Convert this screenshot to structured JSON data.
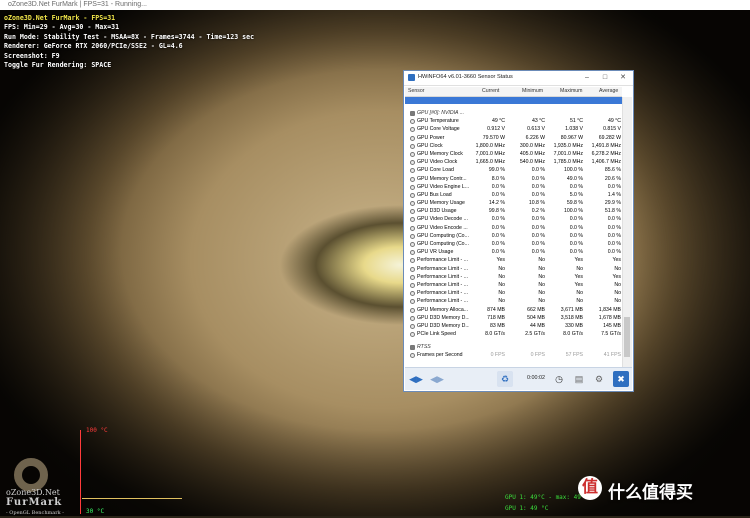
{
  "furmark": {
    "window_title": "oZone3D.Net FurMark | FPS=31 - Running...",
    "hud_title": "oZone3D.Net FurMark - FPS=31",
    "hud_lines": [
      "FPS: Min=29 - Avg=30 - Max=31",
      "Run Mode: Stability Test - MSAA=8X - Frames=3744 - Time=123 sec",
      "Renderer: GeForce RTX 2060/PCIe/SSE2 - GL=4.6",
      "Screenshot: F9",
      "Toggle Fur Rendering: SPACE"
    ],
    "temp_max_label": "100 °C",
    "temp_min_label": "30 °C",
    "logo_top": "oZone3D.Net",
    "logo_big": "FurMark",
    "logo_sub": "- OpenGL Benchmark -",
    "graph_line1": "GPU 1: 49°C - max: 49°C",
    "graph_line2": "GPU 1: 49 °C"
  },
  "watermark": {
    "icon": "值",
    "text": "什么值得买",
    "icon_color": "#cc2e2e"
  },
  "hwinfo": {
    "title": "HWiNFO64 v6.01-3660 Sensor Status",
    "columns": [
      "Sensor",
      "Current",
      "Minimum",
      "Maximum",
      "Average"
    ],
    "group": "GPU [#0]: NVIDIA ...",
    "rows": [
      {
        "name": "GPU Temperature",
        "cur": "49 °C",
        "min": "43 °C",
        "max": "51 °C",
        "avg": "49 °C"
      },
      {
        "name": "GPU Core Voltage",
        "cur": "0.912 V",
        "min": "0.613 V",
        "max": "1.038 V",
        "avg": "0.815 V"
      },
      {
        "name": "GPU Power",
        "cur": "79.570 W",
        "min": "6.226 W",
        "max": "80.967 W",
        "avg": "69.282 W"
      },
      {
        "name": "GPU Clock",
        "cur": "1,800.0 MHz",
        "min": "300.0 MHz",
        "max": "1,935.0 MHz",
        "avg": "1,491.8 MHz"
      },
      {
        "name": "GPU Memory Clock",
        "cur": "7,001.0 MHz",
        "min": "405.0 MHz",
        "max": "7,001.0 MHz",
        "avg": "6,278.2 MHz"
      },
      {
        "name": "GPU Video Clock",
        "cur": "1,665.0 MHz",
        "min": "540.0 MHz",
        "max": "1,785.0 MHz",
        "avg": "1,406.7 MHz"
      },
      {
        "name": "GPU Core Load",
        "cur": "99.0 %",
        "min": "0.0 %",
        "max": "100.0 %",
        "avg": "85.6 %"
      },
      {
        "name": "GPU Memory Contr...",
        "cur": "8.0 %",
        "min": "0.0 %",
        "max": "49.0 %",
        "avg": "20.6 %"
      },
      {
        "name": "GPU Video Engine L...",
        "cur": "0.0 %",
        "min": "0.0 %",
        "max": "0.0 %",
        "avg": "0.0 %"
      },
      {
        "name": "GPU Bus Load",
        "cur": "0.0 %",
        "min": "0.0 %",
        "max": "5.0 %",
        "avg": "1.4 %"
      },
      {
        "name": "GPU Memory Usage",
        "cur": "14.2 %",
        "min": "10.8 %",
        "max": "59.8 %",
        "avg": "29.9 %"
      },
      {
        "name": "GPU D3D Usage",
        "cur": "99.8 %",
        "min": "0.2 %",
        "max": "100.0 %",
        "avg": "51.8 %"
      },
      {
        "name": "GPU Video Decode ...",
        "cur": "0.0 %",
        "min": "0.0 %",
        "max": "0.0 %",
        "avg": "0.0 %"
      },
      {
        "name": "GPU Video Encode ...",
        "cur": "0.0 %",
        "min": "0.0 %",
        "max": "0.0 %",
        "avg": "0.0 %"
      },
      {
        "name": "GPU Computing (Co...",
        "cur": "0.0 %",
        "min": "0.0 %",
        "max": "0.0 %",
        "avg": "0.0 %"
      },
      {
        "name": "GPU Computing (Co...",
        "cur": "0.0 %",
        "min": "0.0 %",
        "max": "0.0 %",
        "avg": "0.0 %"
      },
      {
        "name": "GPU VR Usage",
        "cur": "0.0 %",
        "min": "0.0 %",
        "max": "0.0 %",
        "avg": "0.0 %"
      },
      {
        "name": "Performance Limit - ...",
        "cur": "Yes",
        "min": "No",
        "max": "Yes",
        "avg": "Yes"
      },
      {
        "name": "Performance Limit - ...",
        "cur": "No",
        "min": "No",
        "max": "No",
        "avg": "No"
      },
      {
        "name": "Performance Limit - ...",
        "cur": "No",
        "min": "No",
        "max": "Yes",
        "avg": "Yes"
      },
      {
        "name": "Performance Limit - ...",
        "cur": "No",
        "min": "No",
        "max": "Yes",
        "avg": "No"
      },
      {
        "name": "Performance Limit - ...",
        "cur": "No",
        "min": "No",
        "max": "No",
        "avg": "No"
      },
      {
        "name": "Performance Limit - ...",
        "cur": "No",
        "min": "No",
        "max": "No",
        "avg": "No"
      },
      {
        "name": "GPU Memory Alloca...",
        "cur": "874 MB",
        "min": "662 MB",
        "max": "3,671 MB",
        "avg": "1,834 MB"
      },
      {
        "name": "GPU D3D Memory D...",
        "cur": "718 MB",
        "min": "504 MB",
        "max": "3,518 MB",
        "avg": "1,678 MB"
      },
      {
        "name": "GPU D3D Memory D...",
        "cur": "83 MB",
        "min": "44 MB",
        "max": "330 MB",
        "avg": "145 MB"
      },
      {
        "name": "PCIe Link Speed",
        "cur": "8.0 GT/s",
        "min": "2.5 GT/s",
        "max": "8.0 GT/s",
        "avg": "7.5 GT/s"
      }
    ],
    "group2": "RTSS",
    "rtss_row": {
      "name": "Frames per Second",
      "cur": "0 FPS",
      "min": "0 FPS",
      "max": "57 FPS",
      "avg": "41 FPS"
    },
    "elapsed": "0:00:02"
  }
}
